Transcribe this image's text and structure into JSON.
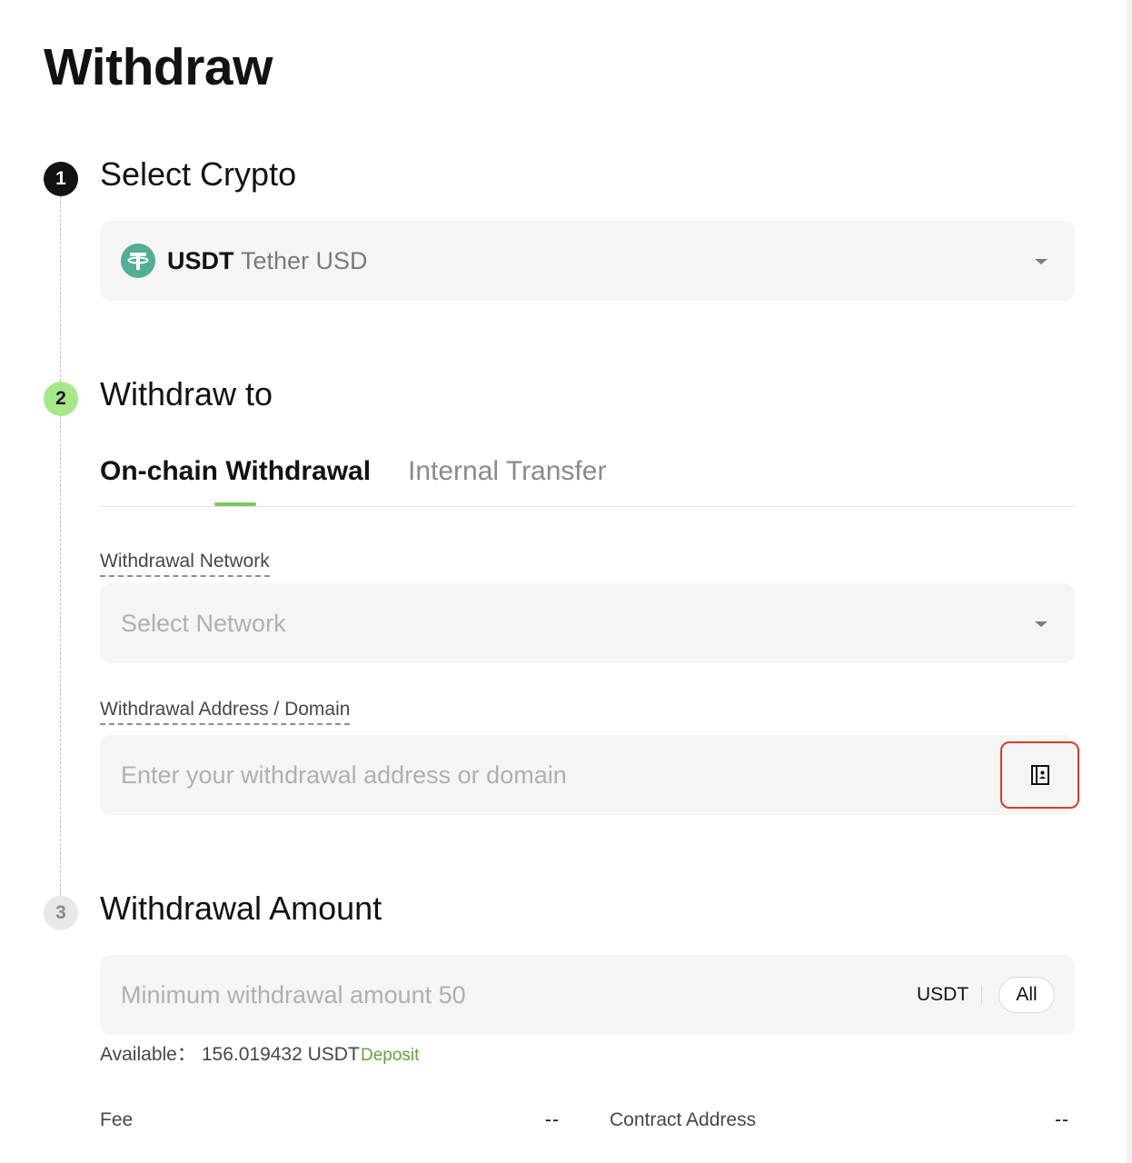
{
  "page": {
    "title": "Withdraw"
  },
  "steps": [
    {
      "number": "1",
      "title": "Select Crypto"
    },
    {
      "number": "2",
      "title": "Withdraw to"
    },
    {
      "number": "3",
      "title": "Withdrawal Amount"
    }
  ],
  "crypto": {
    "icon": "tether-icon",
    "symbol": "USDT",
    "name": "Tether USD",
    "brand_color": "#50AF95"
  },
  "tabs": [
    {
      "label": "On-chain Withdrawal",
      "active": true
    },
    {
      "label": "Internal Transfer",
      "active": false
    }
  ],
  "network": {
    "label": "Withdrawal Network",
    "placeholder": "Select Network"
  },
  "address": {
    "label": "Withdrawal Address / Domain",
    "placeholder": "Enter your withdrawal address or domain",
    "book_icon": "address-book-icon"
  },
  "amount": {
    "placeholder": "Minimum withdrawal amount 50",
    "unit": "USDT",
    "all_label": "All"
  },
  "balance": {
    "label": "Available：",
    "value": "156.019432 USDT",
    "deposit_label": "Deposit"
  },
  "fee": {
    "label": "Fee",
    "value": "--"
  },
  "contract": {
    "label": "Contract Address",
    "value": "--"
  },
  "colors": {
    "accent": "#A6E889",
    "link": "#5FA641",
    "highlight_box": "#E0392B"
  }
}
